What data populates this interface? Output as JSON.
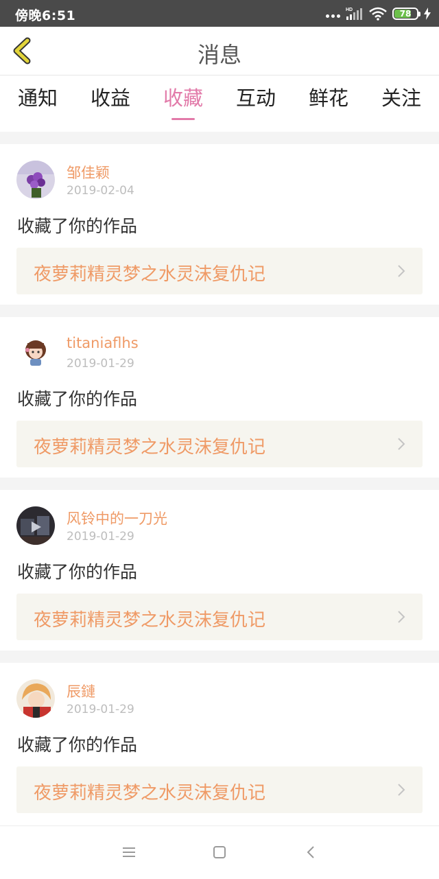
{
  "status_bar": {
    "time": "傍晚6:51",
    "network": "HD",
    "battery": "78"
  },
  "header": {
    "title": "消息"
  },
  "tabs": [
    {
      "label": "通知",
      "active": false
    },
    {
      "label": "收益",
      "active": false
    },
    {
      "label": "收藏",
      "active": true
    },
    {
      "label": "互动",
      "active": false
    },
    {
      "label": "鲜花",
      "active": false
    },
    {
      "label": "关注",
      "active": false
    }
  ],
  "messages": [
    {
      "user": "邹佳颖",
      "date": "2019-02-04",
      "action": "收藏了你的作品",
      "work": "夜萝莉精灵梦之水灵沫复仇记",
      "avatar": "flower-avatar"
    },
    {
      "user": "titaniaflhs",
      "date": "2019-01-29",
      "action": "收藏了你的作品",
      "work": "夜萝莉精灵梦之水灵沫复仇记",
      "avatar": "cartoon-girl-avatar"
    },
    {
      "user": "风铃中的一刀光",
      "date": "2019-01-29",
      "action": "收藏了你的作品",
      "work": "夜萝莉精灵梦之水灵沫复仇记",
      "avatar": "dark-photo-avatar"
    },
    {
      "user": "辰鏈",
      "date": "2019-01-29",
      "action": "收藏了你的作品",
      "work": "夜萝莉精灵梦之水灵沫复仇记",
      "avatar": "anime-boy-avatar"
    }
  ],
  "nav_bar": {
    "icons": [
      "menu-icon",
      "home-icon",
      "back-icon"
    ]
  },
  "colors": {
    "accent_pink": "#e27aa9",
    "orange_text": "#ef9a66",
    "work_bg": "#f6f5ef",
    "back_arrow": "#e2d43a"
  }
}
